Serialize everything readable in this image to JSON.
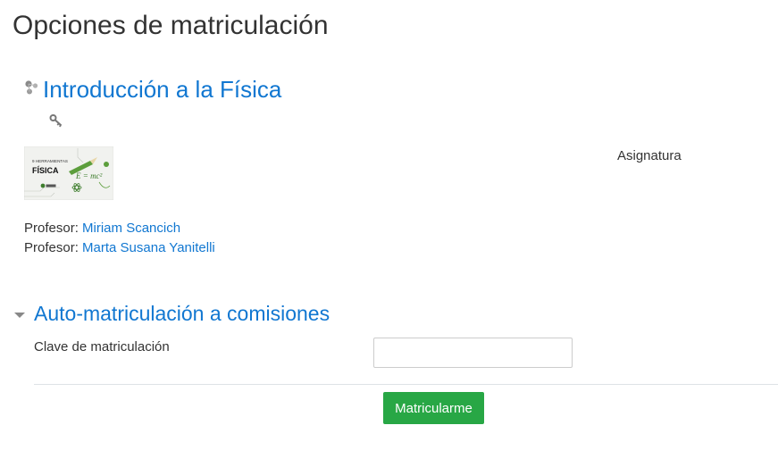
{
  "page": {
    "title": "Opciones de matriculación"
  },
  "course": {
    "name": "Introducción a la Física",
    "icon": "course-icon",
    "enrolment_icon": "key-icon",
    "category": "Asignatura",
    "image": {
      "heading_small": "9 HERRAMIENTAS",
      "heading_big": "FÍSICA",
      "formula": "E = mc²"
    },
    "teachers": [
      {
        "role": "Profesor:",
        "name": "Miriam Scancich"
      },
      {
        "role": "Profesor:",
        "name": "Marta Susana Yanitelli"
      }
    ]
  },
  "self_enrol": {
    "section_title": "Auto-matriculación a comisiones",
    "toggle_icon": "caret-down-icon",
    "key_label": "Clave de matriculación",
    "key_value": "",
    "submit_label": "Matricularme"
  },
  "colors": {
    "link": "#1177d1",
    "text": "#333333",
    "button": "#28a745",
    "divider": "#dee2e6"
  }
}
